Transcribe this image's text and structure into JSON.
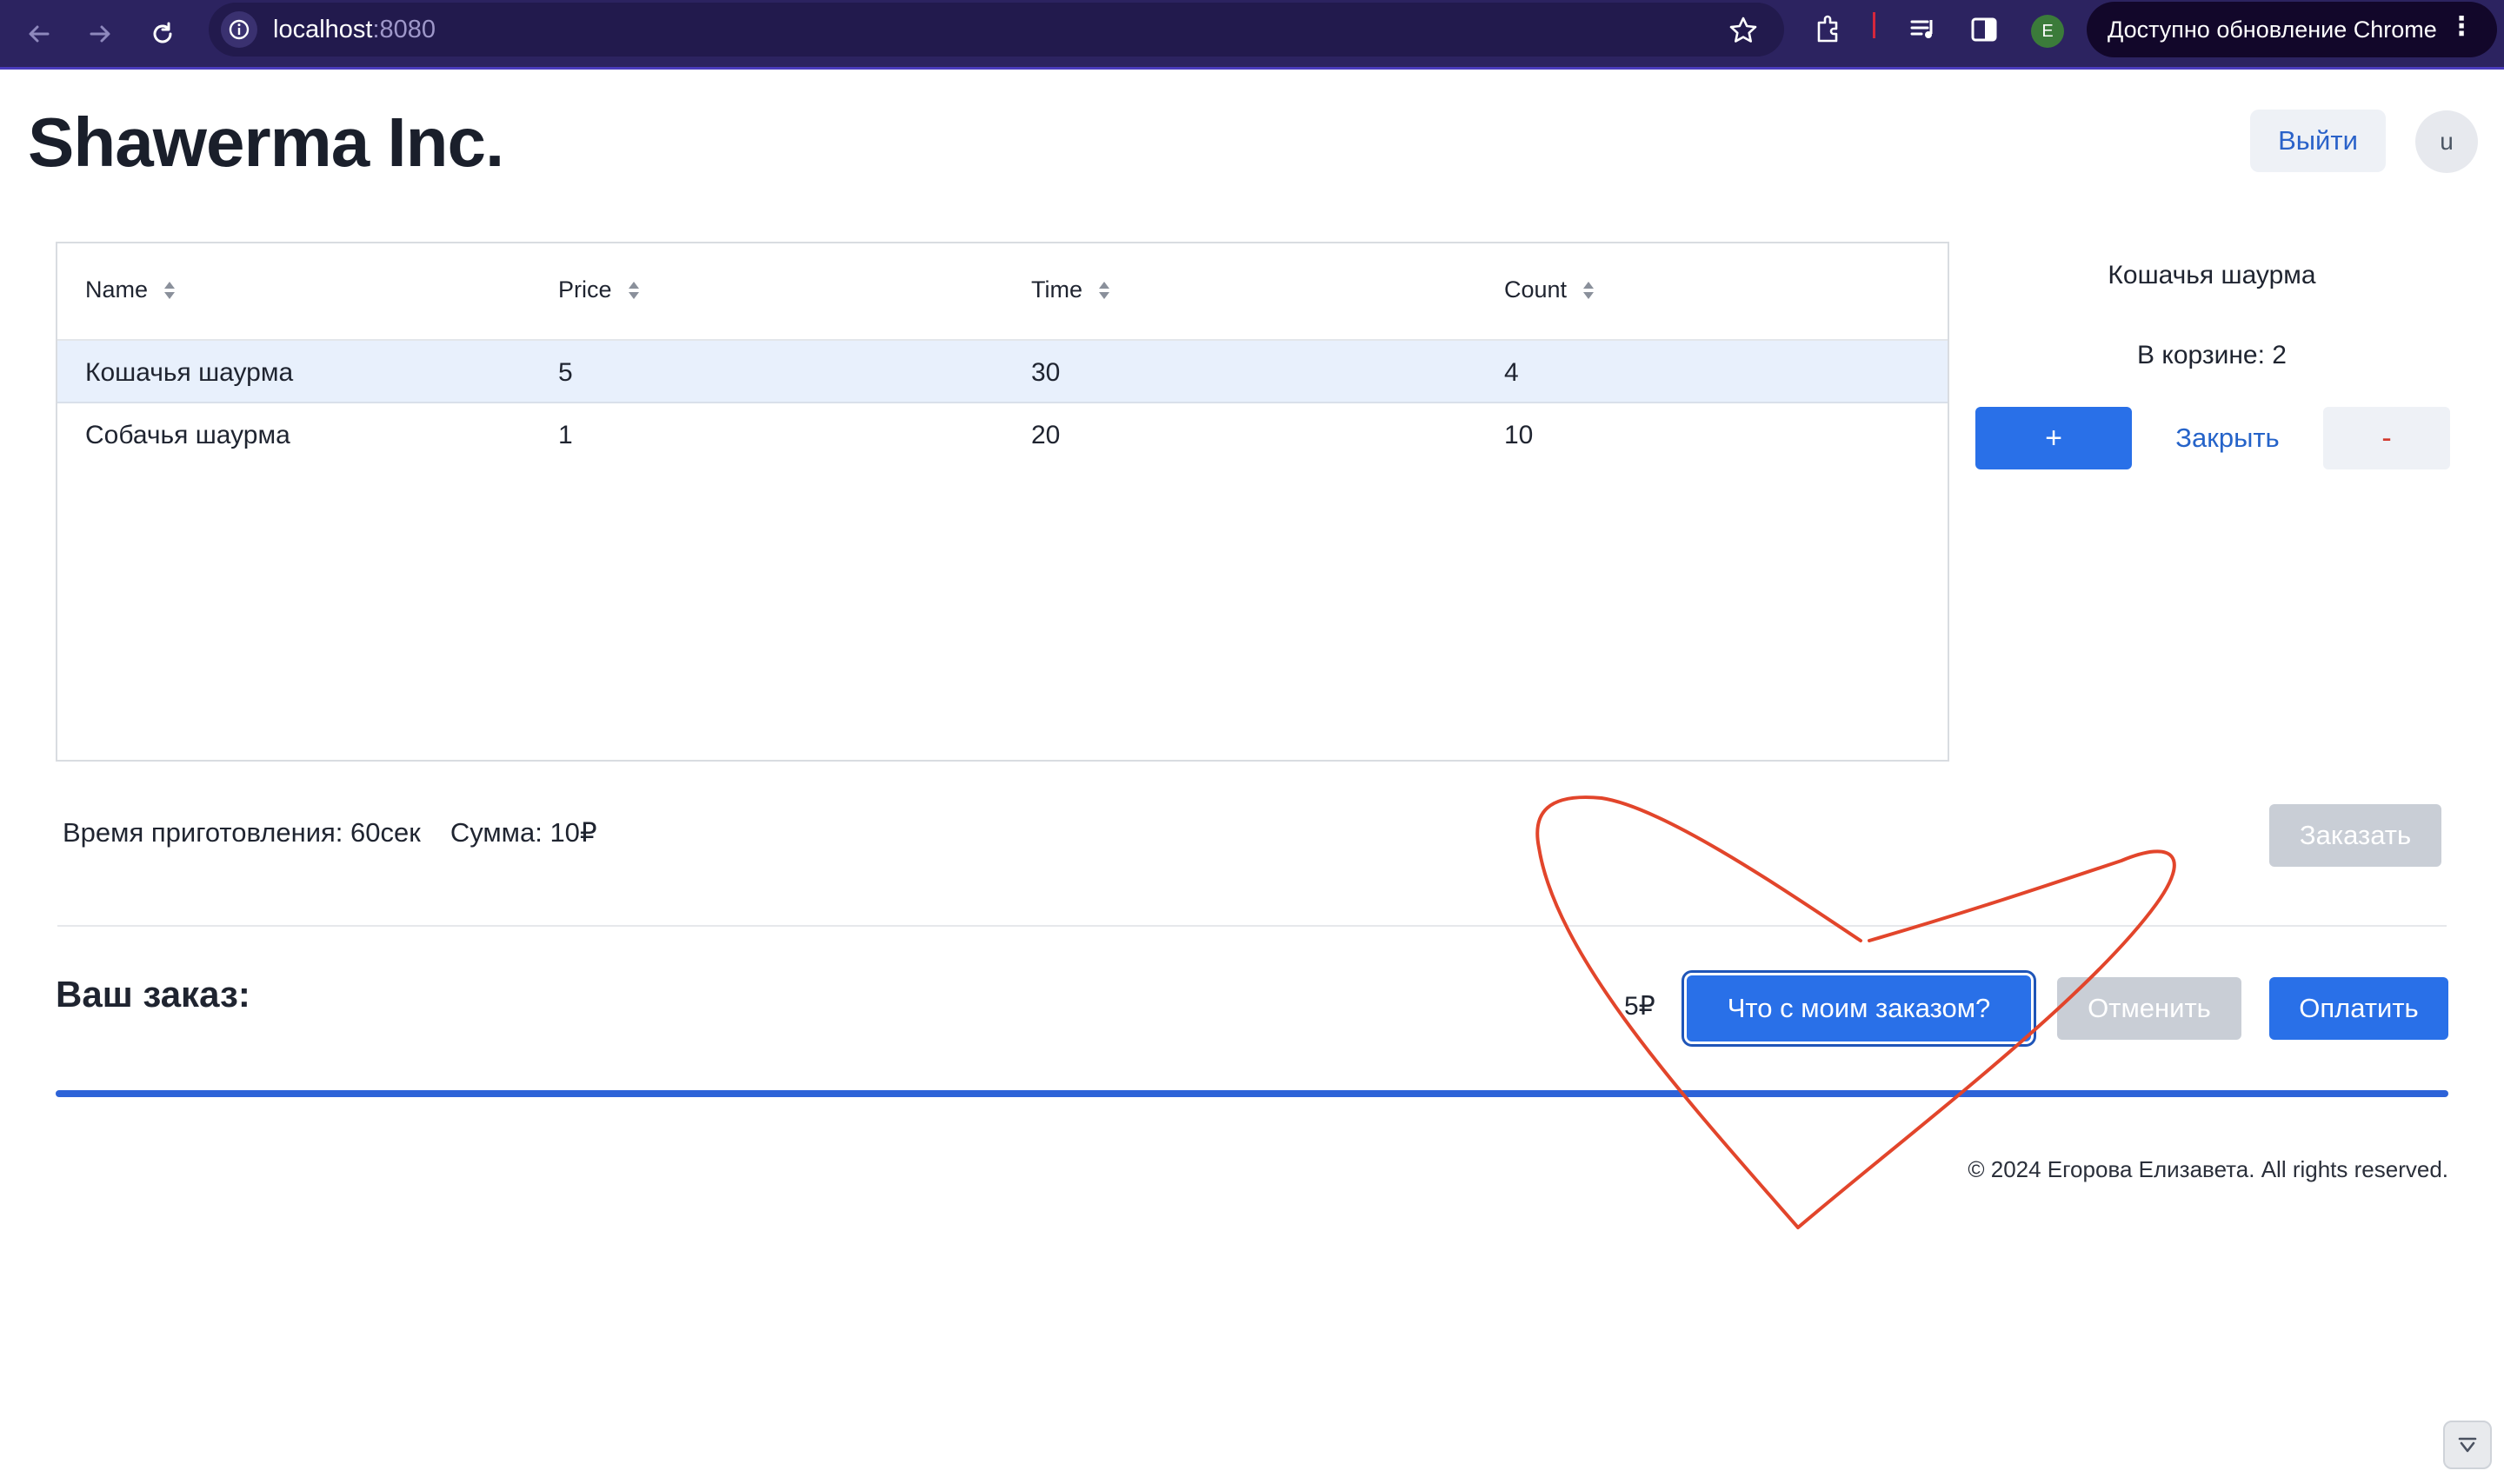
{
  "browser": {
    "url_host": "localhost",
    "url_port": ":8080",
    "profile_letter": "E",
    "update_label": "Доступно обновление Chrome"
  },
  "header": {
    "brand": "Shawerma Inc.",
    "logout_label": "Выйти",
    "avatar_letter": "u"
  },
  "table": {
    "columns": [
      "Name",
      "Price",
      "Time",
      "Count"
    ],
    "rows": [
      {
        "name": "Кошачья шаурма",
        "price": "5",
        "time": "30",
        "count": "4",
        "selected": true
      },
      {
        "name": "Собачья шаурма",
        "price": "1",
        "time": "20",
        "count": "10",
        "selected": false
      }
    ]
  },
  "side_panel": {
    "title": "Кошачья шаурма",
    "basket": "В корзине: 2",
    "plus_label": "+",
    "close_label": "Закрыть",
    "minus_label": "-"
  },
  "summary": {
    "prep_time": "Время приготовления: 60сек",
    "sum": "Сумма: 10₽",
    "order_label": "Заказать"
  },
  "order": {
    "heading": "Ваш заказ:",
    "price": "5₽",
    "status_label": "Что с моим заказом?",
    "cancel_label": "Отменить",
    "pay_label": "Оплатить",
    "progress_fraction": 1.0
  },
  "footer": {
    "copyright": "© 2024 Егорова Елизавета. All rights reserved."
  },
  "colors": {
    "accent": "#2970e8",
    "heart_stroke": "#e2452b",
    "browser_bar": "#2c2360"
  }
}
